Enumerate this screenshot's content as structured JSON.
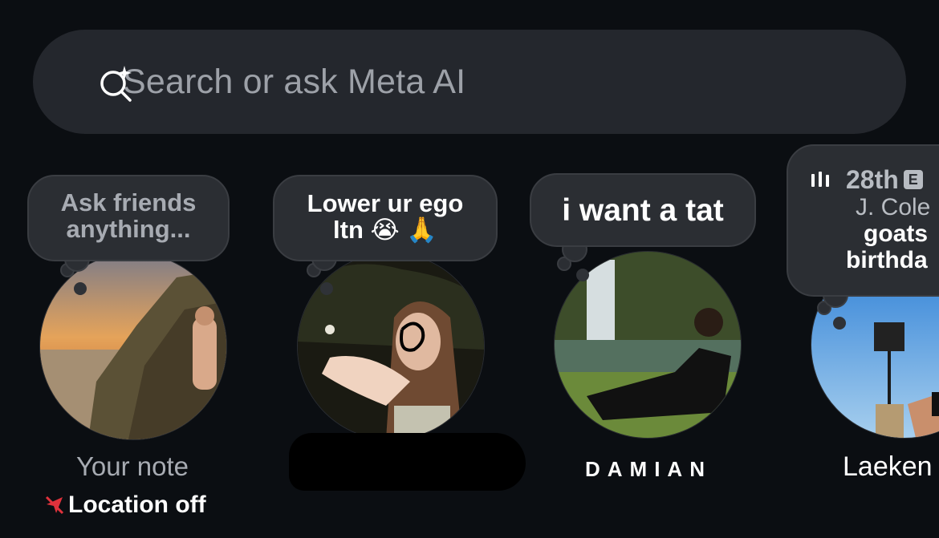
{
  "search": {
    "placeholder": "Search or ask Meta AI",
    "icon": "meta-ai-search-icon"
  },
  "notes": [
    {
      "bubble_text_line1": "Ask friends",
      "bubble_text_line2": "anything...",
      "name": "Your note",
      "location_status": "Location off",
      "location_icon": "location-off-icon"
    },
    {
      "bubble_text_line1": "Lower ur ego",
      "bubble_text_line2": "ltn 😭 🙏",
      "name": ""
    },
    {
      "bubble_text": "i want a tat",
      "name": "DAMIAN"
    },
    {
      "music_icon": "music-bars-icon",
      "song_title": "28th",
      "explicit_badge": "E",
      "artist": "J. Cole",
      "bubble_text_line1": "goats",
      "bubble_text_line2": "birthda",
      "name": "Laeken"
    }
  ],
  "colors": {
    "background": "#0b0e12",
    "search_bg": "#24272d",
    "bubble_bg": "#2b2e33",
    "location_off_red": "#e0323c"
  }
}
